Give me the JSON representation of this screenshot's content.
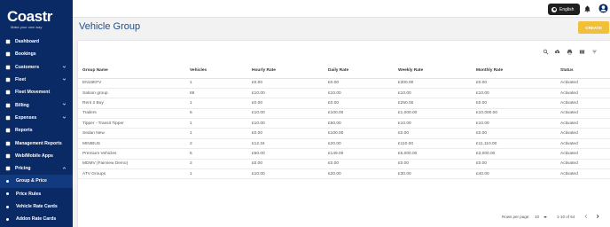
{
  "brand": {
    "name": "Coastr",
    "tagline": "Make your own way"
  },
  "sidebar": {
    "items": [
      {
        "label": "Dashboard",
        "icon": "dashboard-icon",
        "chevron": false
      },
      {
        "label": "Bookings",
        "icon": "calendar-icon",
        "chevron": false
      },
      {
        "label": "Customers",
        "icon": "people-icon",
        "chevron": true
      },
      {
        "label": "Fleet",
        "icon": "car-icon",
        "chevron": true
      },
      {
        "label": "Fleet Movement",
        "icon": "truck-icon",
        "chevron": false
      },
      {
        "label": "Billing",
        "icon": "receipt-icon",
        "chevron": true
      },
      {
        "label": "Expenses",
        "icon": "wallet-icon",
        "chevron": true
      },
      {
        "label": "Reports",
        "icon": "report-icon",
        "chevron": false
      },
      {
        "label": "Management Reports",
        "icon": "chart-icon",
        "chevron": false
      },
      {
        "label": "Web/Mobile Apps",
        "icon": "mobile-icon",
        "chevron": false
      },
      {
        "label": "Pricing",
        "icon": "tag-icon",
        "chevron": true,
        "expanded": true
      }
    ],
    "subitems": [
      {
        "label": "Group & Price",
        "active": true
      },
      {
        "label": "Price Rules"
      },
      {
        "label": "Vehicle Rate Cards"
      },
      {
        "label": "Addon Rate Cards"
      }
    ]
  },
  "topbar": {
    "language": "English"
  },
  "page": {
    "title": "Vehicle Group",
    "create_label": "CREATE"
  },
  "table": {
    "columns": [
      "Group Name",
      "Vehicles",
      "Hourly Rate",
      "Daily Rate",
      "Weekly Rate",
      "Monthly Rate",
      "Status"
    ],
    "rows": [
      [
        "EN18KFV",
        "1",
        "£0.00",
        "£0.00",
        "£300.00",
        "£0.00",
        "Activated"
      ],
      [
        "Saloon group",
        "69",
        "£10.00",
        "£10.00",
        "£10.00",
        "£10.00",
        "Activated"
      ],
      [
        "Rent 2 Buy",
        "1",
        "£0.00",
        "£0.00",
        "£250.00",
        "£0.00",
        "Activated"
      ],
      [
        "Trailers",
        "6",
        "£10.00",
        "£100.00",
        "£1,000.00",
        "£10,000.00",
        "Activated"
      ],
      [
        "Tipper - Transit Tipper",
        "1",
        "£10.00",
        "£50.00",
        "£10.00",
        "£10.00",
        "Activated"
      ],
      [
        "Sedan New",
        "1",
        "£0.00",
        "£100.00",
        "£0.00",
        "£0.00",
        "Activated"
      ],
      [
        "MINIBUS",
        "2",
        "£12.34",
        "£20.00",
        "£110.00",
        "£11,110.00",
        "Activated"
      ],
      [
        "Premium Vehicles",
        "6",
        "£50.00",
        "£149.00",
        "£5,000.00",
        "£3,000.00",
        "Activated"
      ],
      [
        "MDMV (Fairview Demo)",
        "2",
        "£0.00",
        "£0.00",
        "£0.00",
        "£0.00",
        "Activated"
      ],
      [
        "ATV Groups",
        "1",
        "£10.00",
        "£20.00",
        "£30.00",
        "£40.00",
        "Activated"
      ]
    ]
  },
  "pager": {
    "rows_per_page_label": "Rows per page:",
    "rows_per_page": "10",
    "range": "1-10 of 64"
  }
}
